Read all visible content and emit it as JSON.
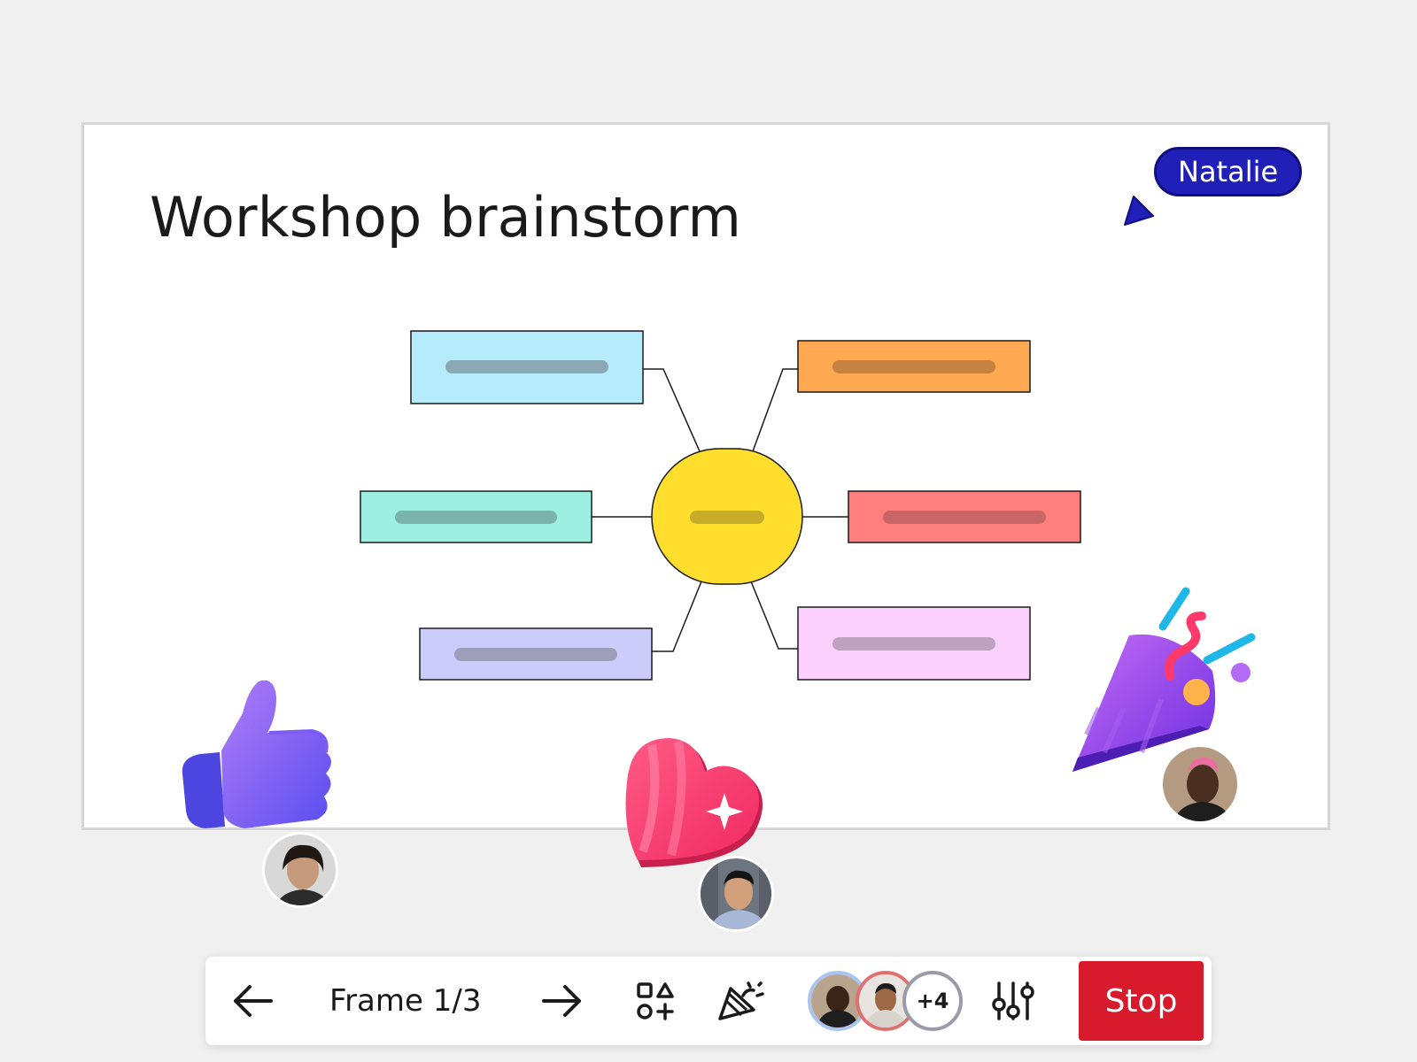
{
  "frame": {
    "title": "Workshop brainstorm"
  },
  "collaborator_cursor": {
    "name": "Natalie",
    "color": "#2020b8"
  },
  "mindmap": {
    "center_color": "#ffde2e",
    "node_colors": [
      "#b5ebfb",
      "#ffa952",
      "#9df0e1",
      "#ff7f7f",
      "#ccccfb",
      "#fbd0fd"
    ]
  },
  "reactions": [
    {
      "name": "thumbs-up-icon"
    },
    {
      "name": "heart-icon"
    },
    {
      "name": "party-popper-icon"
    }
  ],
  "toolbar": {
    "frame_label": "Frame 1/3",
    "more_participants": "+4",
    "stop_label": "Stop",
    "stop_color": "#d71a2c"
  }
}
